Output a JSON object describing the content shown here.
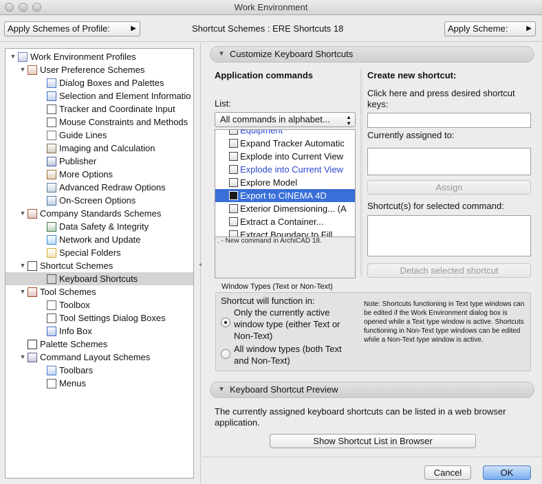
{
  "window": {
    "title": "Work Environment"
  },
  "toolbar": {
    "apply_profile_label": "Apply Schemes of Profile:",
    "scheme_title": "Shortcut Schemes : ERE Shortcuts 18",
    "apply_scheme_label": "Apply Scheme:"
  },
  "tree": {
    "items": [
      {
        "label": "Work Environment Profiles",
        "icon": "profiles-icon"
      },
      {
        "label": "User Preference Schemes",
        "icon": "user-prefs-icon"
      },
      {
        "label": "Dialog Boxes and Palettes",
        "icon": "dialog-icon"
      },
      {
        "label": "Selection and Element Informatio",
        "icon": "selection-icon"
      },
      {
        "label": "Tracker and Coordinate Input",
        "icon": "tracker-icon"
      },
      {
        "label": "Mouse Constraints and Methods",
        "icon": "mouse-icon"
      },
      {
        "label": "Guide Lines",
        "icon": "guide-lines-icon"
      },
      {
        "label": "Imaging and Calculation",
        "icon": "imaging-icon"
      },
      {
        "label": "Publisher",
        "icon": "publisher-icon"
      },
      {
        "label": "More Options",
        "icon": "options-icon"
      },
      {
        "label": "Advanced Redraw Options",
        "icon": "redraw-icon"
      },
      {
        "label": "On-Screen Options",
        "icon": "onscreen-icon"
      },
      {
        "label": "Company Standards Schemes",
        "icon": "company-icon"
      },
      {
        "label": "Data Safety & Integrity",
        "icon": "safety-icon"
      },
      {
        "label": "Network and Update",
        "icon": "network-icon"
      },
      {
        "label": "Special Folders",
        "icon": "folder-icon"
      },
      {
        "label": "Shortcut Schemes",
        "icon": "shortcut-schemes-icon"
      },
      {
        "label": "Keyboard Shortcuts",
        "icon": "keyboard-icon"
      },
      {
        "label": "Tool Schemes",
        "icon": "tool-schemes-icon"
      },
      {
        "label": "Toolbox",
        "icon": "toolbox-icon"
      },
      {
        "label": "Tool Settings Dialog Boxes",
        "icon": "tool-settings-icon"
      },
      {
        "label": "Info Box",
        "icon": "info-box-icon"
      },
      {
        "label": "Palette Schemes",
        "icon": "palette-icon"
      },
      {
        "label": "Command Layout Schemes",
        "icon": "command-layout-icon"
      },
      {
        "label": "Toolbars",
        "icon": "toolbars-icon"
      },
      {
        "label": "Menus",
        "icon": "menus-icon"
      }
    ]
  },
  "customize": {
    "header": "Customize Keyboard Shortcuts",
    "app_commands_title": "Application commands",
    "list_label": "List:",
    "list_value": "All commands in alphabet...",
    "commands": [
      {
        "label": "Equipment"
      },
      {
        "label": "Expand Tracker Automatic"
      },
      {
        "label": "Explode into Current View"
      },
      {
        "label": "Explode into Current View"
      },
      {
        "label": "Explore Model"
      },
      {
        "label": "Export to CINEMA 4D"
      },
      {
        "label": "Exterior Dimensioning... (A"
      },
      {
        "label": "Extract a Container..."
      },
      {
        "label": "Extract Boundary to Fill"
      }
    ],
    "legend_note": ". - New command in ArchiCAD 18.",
    "create_title": "Create new shortcut:",
    "create_hint": "Click here and press desired shortcut keys:",
    "shortcut_value": "",
    "assigned_label": "Currently assigned to:",
    "assign_button": "Assign",
    "selected_label": "Shortcut(s) for selected command:",
    "detach_button": "Detach selected shortcut"
  },
  "window_types": {
    "title": "Window Types (Text or Non-Text)",
    "function_label": "Shortcut will function in:",
    "option1": "Only the currently active window type (either Text or Non-Text)",
    "option2": "All window types (both Text and Non-Text)",
    "note": "Note: Shortcuts functioning in Text type windows can be edited if the Work Environment dialog box is opened while a Text type window is active. Shortcuts functioning in Non-Text type windows can be edited while a Non-Text type window is active."
  },
  "preview": {
    "header": "Keyboard Shortcut Preview",
    "description": "The currently assigned keyboard shortcuts can be listed in a web browser application.",
    "show_button": "Show Shortcut List in Browser"
  },
  "footer": {
    "cancel": "Cancel",
    "ok": "OK"
  },
  "colors": {
    "selection": "#3a6fd8",
    "link_blue": "#2b47d0",
    "ok_blue": "#79aef0"
  }
}
